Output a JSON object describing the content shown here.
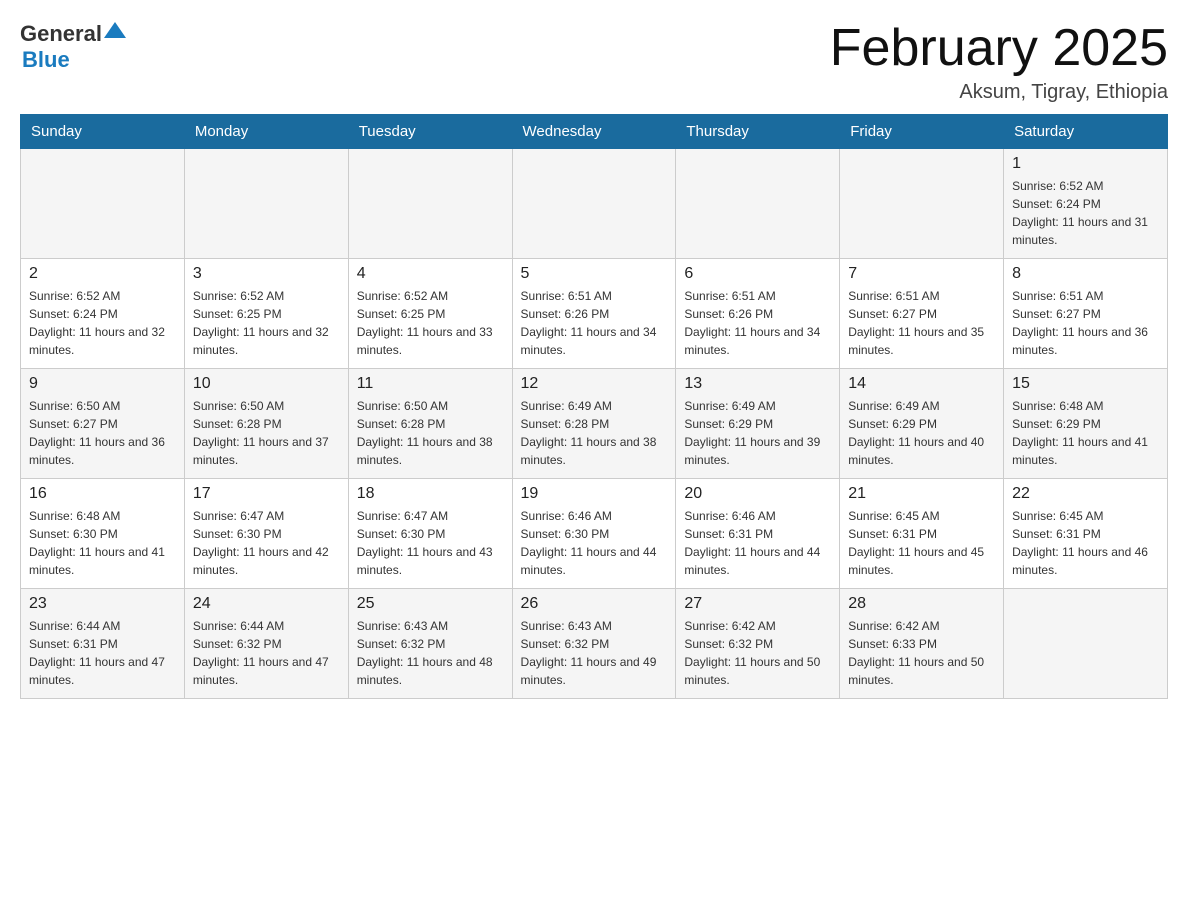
{
  "header": {
    "logo": {
      "general": "General",
      "blue": "Blue"
    },
    "title": "February 2025",
    "subtitle": "Aksum, Tigray, Ethiopia"
  },
  "calendar": {
    "weekdays": [
      "Sunday",
      "Monday",
      "Tuesday",
      "Wednesday",
      "Thursday",
      "Friday",
      "Saturday"
    ],
    "rows": [
      [
        {
          "day": "",
          "info": ""
        },
        {
          "day": "",
          "info": ""
        },
        {
          "day": "",
          "info": ""
        },
        {
          "day": "",
          "info": ""
        },
        {
          "day": "",
          "info": ""
        },
        {
          "day": "",
          "info": ""
        },
        {
          "day": "1",
          "info": "Sunrise: 6:52 AM\nSunset: 6:24 PM\nDaylight: 11 hours and 31 minutes."
        }
      ],
      [
        {
          "day": "2",
          "info": "Sunrise: 6:52 AM\nSunset: 6:24 PM\nDaylight: 11 hours and 32 minutes."
        },
        {
          "day": "3",
          "info": "Sunrise: 6:52 AM\nSunset: 6:25 PM\nDaylight: 11 hours and 32 minutes."
        },
        {
          "day": "4",
          "info": "Sunrise: 6:52 AM\nSunset: 6:25 PM\nDaylight: 11 hours and 33 minutes."
        },
        {
          "day": "5",
          "info": "Sunrise: 6:51 AM\nSunset: 6:26 PM\nDaylight: 11 hours and 34 minutes."
        },
        {
          "day": "6",
          "info": "Sunrise: 6:51 AM\nSunset: 6:26 PM\nDaylight: 11 hours and 34 minutes."
        },
        {
          "day": "7",
          "info": "Sunrise: 6:51 AM\nSunset: 6:27 PM\nDaylight: 11 hours and 35 minutes."
        },
        {
          "day": "8",
          "info": "Sunrise: 6:51 AM\nSunset: 6:27 PM\nDaylight: 11 hours and 36 minutes."
        }
      ],
      [
        {
          "day": "9",
          "info": "Sunrise: 6:50 AM\nSunset: 6:27 PM\nDaylight: 11 hours and 36 minutes."
        },
        {
          "day": "10",
          "info": "Sunrise: 6:50 AM\nSunset: 6:28 PM\nDaylight: 11 hours and 37 minutes."
        },
        {
          "day": "11",
          "info": "Sunrise: 6:50 AM\nSunset: 6:28 PM\nDaylight: 11 hours and 38 minutes."
        },
        {
          "day": "12",
          "info": "Sunrise: 6:49 AM\nSunset: 6:28 PM\nDaylight: 11 hours and 38 minutes."
        },
        {
          "day": "13",
          "info": "Sunrise: 6:49 AM\nSunset: 6:29 PM\nDaylight: 11 hours and 39 minutes."
        },
        {
          "day": "14",
          "info": "Sunrise: 6:49 AM\nSunset: 6:29 PM\nDaylight: 11 hours and 40 minutes."
        },
        {
          "day": "15",
          "info": "Sunrise: 6:48 AM\nSunset: 6:29 PM\nDaylight: 11 hours and 41 minutes."
        }
      ],
      [
        {
          "day": "16",
          "info": "Sunrise: 6:48 AM\nSunset: 6:30 PM\nDaylight: 11 hours and 41 minutes."
        },
        {
          "day": "17",
          "info": "Sunrise: 6:47 AM\nSunset: 6:30 PM\nDaylight: 11 hours and 42 minutes."
        },
        {
          "day": "18",
          "info": "Sunrise: 6:47 AM\nSunset: 6:30 PM\nDaylight: 11 hours and 43 minutes."
        },
        {
          "day": "19",
          "info": "Sunrise: 6:46 AM\nSunset: 6:30 PM\nDaylight: 11 hours and 44 minutes."
        },
        {
          "day": "20",
          "info": "Sunrise: 6:46 AM\nSunset: 6:31 PM\nDaylight: 11 hours and 44 minutes."
        },
        {
          "day": "21",
          "info": "Sunrise: 6:45 AM\nSunset: 6:31 PM\nDaylight: 11 hours and 45 minutes."
        },
        {
          "day": "22",
          "info": "Sunrise: 6:45 AM\nSunset: 6:31 PM\nDaylight: 11 hours and 46 minutes."
        }
      ],
      [
        {
          "day": "23",
          "info": "Sunrise: 6:44 AM\nSunset: 6:31 PM\nDaylight: 11 hours and 47 minutes."
        },
        {
          "day": "24",
          "info": "Sunrise: 6:44 AM\nSunset: 6:32 PM\nDaylight: 11 hours and 47 minutes."
        },
        {
          "day": "25",
          "info": "Sunrise: 6:43 AM\nSunset: 6:32 PM\nDaylight: 11 hours and 48 minutes."
        },
        {
          "day": "26",
          "info": "Sunrise: 6:43 AM\nSunset: 6:32 PM\nDaylight: 11 hours and 49 minutes."
        },
        {
          "day": "27",
          "info": "Sunrise: 6:42 AM\nSunset: 6:32 PM\nDaylight: 11 hours and 50 minutes."
        },
        {
          "day": "28",
          "info": "Sunrise: 6:42 AM\nSunset: 6:33 PM\nDaylight: 11 hours and 50 minutes."
        },
        {
          "day": "",
          "info": ""
        }
      ]
    ]
  }
}
